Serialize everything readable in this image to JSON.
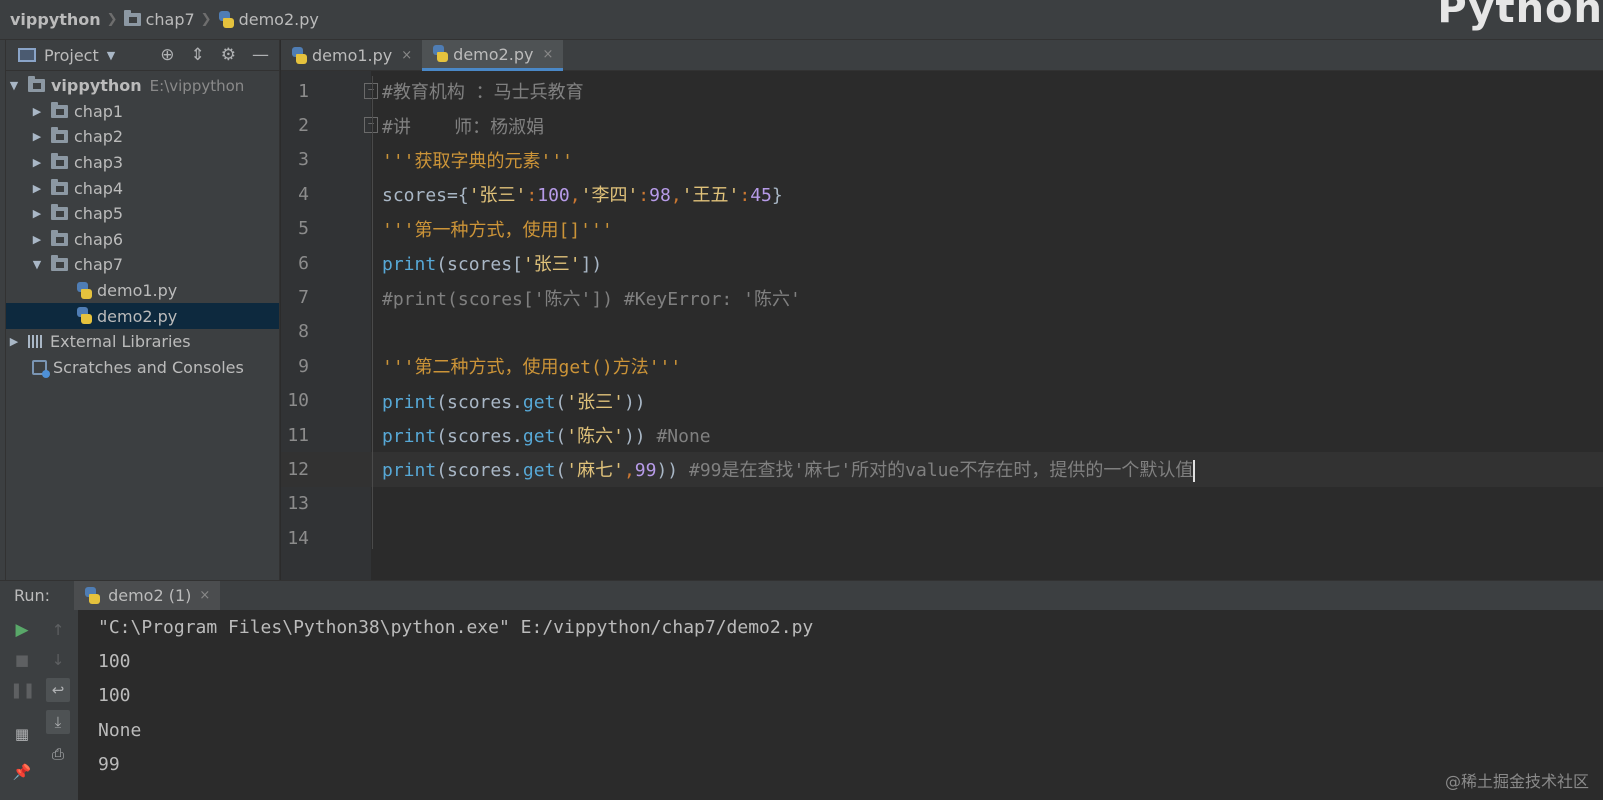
{
  "breadcrumb": {
    "project": "vippython",
    "folder": "chap7",
    "file": "demo2.py",
    "corner_text": "Python"
  },
  "project_panel": {
    "title": "Project",
    "root": {
      "name": "vippython",
      "path": "E:\\vippython"
    },
    "folders": [
      "chap1",
      "chap2",
      "chap3",
      "chap4",
      "chap5",
      "chap6",
      "chap7"
    ],
    "files": [
      "demo1.py",
      "demo2.py"
    ],
    "external_libraries": "External Libraries",
    "scratches": "Scratches and Consoles"
  },
  "tabs": [
    {
      "label": "demo1.py",
      "close": "×"
    },
    {
      "label": "demo2.py",
      "close": "×"
    }
  ],
  "line_numbers": [
    "1",
    "2",
    "3",
    "4",
    "5",
    "6",
    "7",
    "8",
    "9",
    "10",
    "11",
    "12",
    "13",
    "14"
  ],
  "code": {
    "l1": "#教育机构 ：马士兵教育",
    "l2": "#讲    师：杨淑娟",
    "l3": "'''获取字典的元素'''",
    "l4": {
      "a": "scores",
      "b": "=",
      "c": "{",
      "d": "'张三'",
      "e": ":",
      "f": "100",
      "g": ",",
      "h": "'李四'",
      "i": ":",
      "j": "98",
      "k": ",",
      "l": "'王五'",
      "m": ":",
      "n": "45",
      "o": "}"
    },
    "l5": "'''第一种方式，使用[]'''",
    "l6": {
      "a": "print",
      "b": "(scores[",
      "c": "'张三'",
      "d": "])"
    },
    "l7": "#print(scores['陈六']) #KeyError: '陈六'",
    "l9": "'''第二种方式，使用get()方法'''",
    "l10": {
      "a": "print",
      "b": "(scores.",
      "c": "get",
      "d": "(",
      "e": "'张三'",
      "f": "))"
    },
    "l11": {
      "a": "print",
      "b": "(scores.",
      "c": "get",
      "d": "(",
      "e": "'陈六'",
      "f": ")) ",
      "g": "#None"
    },
    "l12": {
      "a": "print",
      "b": "(scores.",
      "c": "get",
      "d": "(",
      "e": "'麻七'",
      "f": ",",
      "g": "99",
      "h": ")) ",
      "i": "#99是在查找'麻七'所对的value不存在时，提供的一个默认值"
    }
  },
  "run": {
    "label": "Run:",
    "tab": "demo2 (1)",
    "close": "×",
    "output": [
      "\"C:\\Program Files\\Python38\\python.exe\" E:/vippython/chap7/demo2.py",
      "100",
      "100",
      "None",
      "99"
    ]
  },
  "watermark": "@稀土掘金技术社区",
  "colors": {
    "selection": "#0d293e",
    "tab_accent": "#4a88c7",
    "run_green": "#59a869"
  }
}
